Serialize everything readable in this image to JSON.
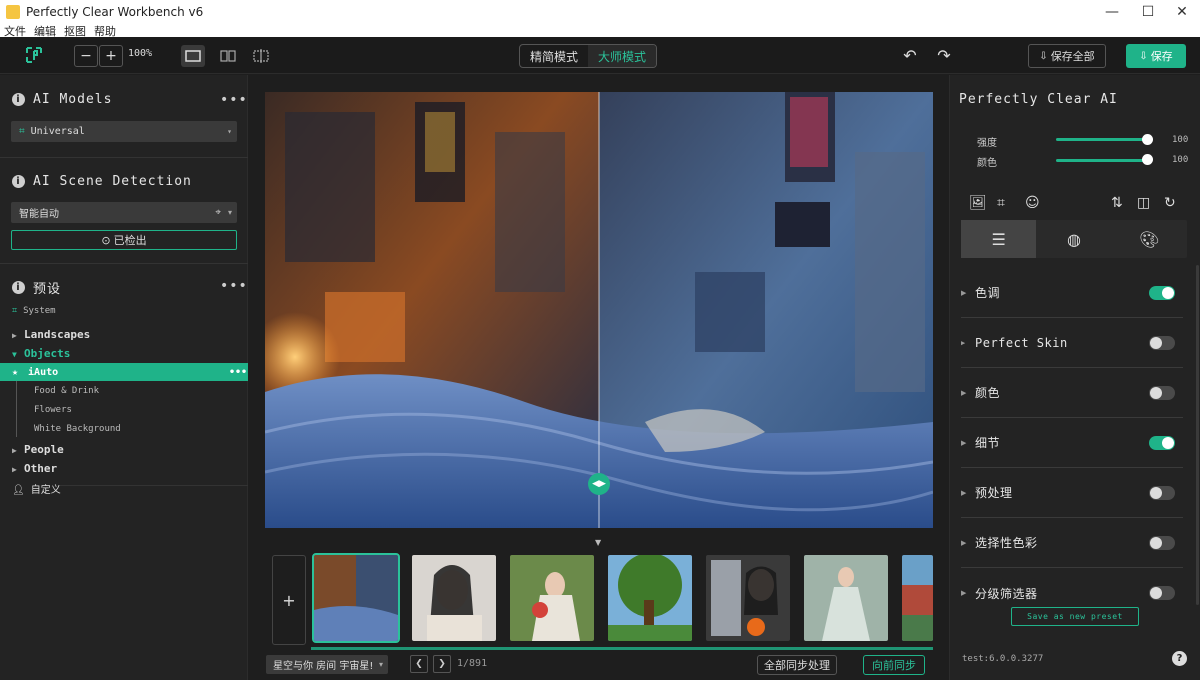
{
  "window": {
    "title": "Perfectly Clear Workbench v6",
    "minimize": "—",
    "maximize": "☐",
    "close": "✕"
  },
  "menu": [
    "文件",
    "编辑",
    "抠图",
    "帮助"
  ],
  "toolbar": {
    "zoom_minus": "−",
    "zoom_plus": "+",
    "zoom_level": "100%",
    "modes": [
      "精简模式",
      "大师模式"
    ],
    "active_mode": 1,
    "save_all_label": "保存全部",
    "save_label": "保存"
  },
  "left_panel": {
    "ai_models": {
      "title": "AI Models",
      "more": "•••",
      "selected": "Universal"
    },
    "scene_detection": {
      "title": "AI Scene Detection",
      "more": "•••",
      "selected": "智能自动",
      "detected_label": "已检出"
    },
    "presets": {
      "title": "预设",
      "more": "•••",
      "system_label": "System",
      "groups": [
        {
          "label": "Landscapes",
          "expanded": false
        },
        {
          "label": "Objects",
          "expanded": true,
          "items": [
            {
              "label": "iAuto",
              "selected": true,
              "more": "•••"
            },
            {
              "label": "Food & Drink"
            },
            {
              "label": "Flowers"
            },
            {
              "label": "White Background"
            }
          ]
        },
        {
          "label": "People",
          "expanded": false
        },
        {
          "label": "Other",
          "expanded": false
        }
      ],
      "custom_label": "自定义"
    }
  },
  "canvas": {
    "add_label": "+",
    "folder": "星空与你 房间 宇宙星!",
    "counter": "1/891",
    "sync_all_label": "全部同步处理",
    "sync_forward_label": "向前同步"
  },
  "right_panel": {
    "title": "Perfectly Clear AI",
    "sliders": [
      {
        "label": "强度",
        "value": "100"
      },
      {
        "label": "颜色",
        "value": "100"
      }
    ],
    "adjustments": [
      {
        "label": "色调",
        "on": true
      },
      {
        "label": "Perfect Skin",
        "on": false
      },
      {
        "label": "颜色",
        "on": false
      },
      {
        "label": "细节",
        "on": true
      },
      {
        "label": "预处理",
        "on": false
      },
      {
        "label": "选择性色彩",
        "on": false
      },
      {
        "label": "分级筛选器",
        "on": false
      }
    ],
    "save_preset_label": "Save as new preset",
    "version": "test:6.0.0.3277",
    "help": "?"
  },
  "colors": {
    "accent": "#1fb389",
    "bg": "#1e1e1e",
    "panel": "#232323"
  }
}
